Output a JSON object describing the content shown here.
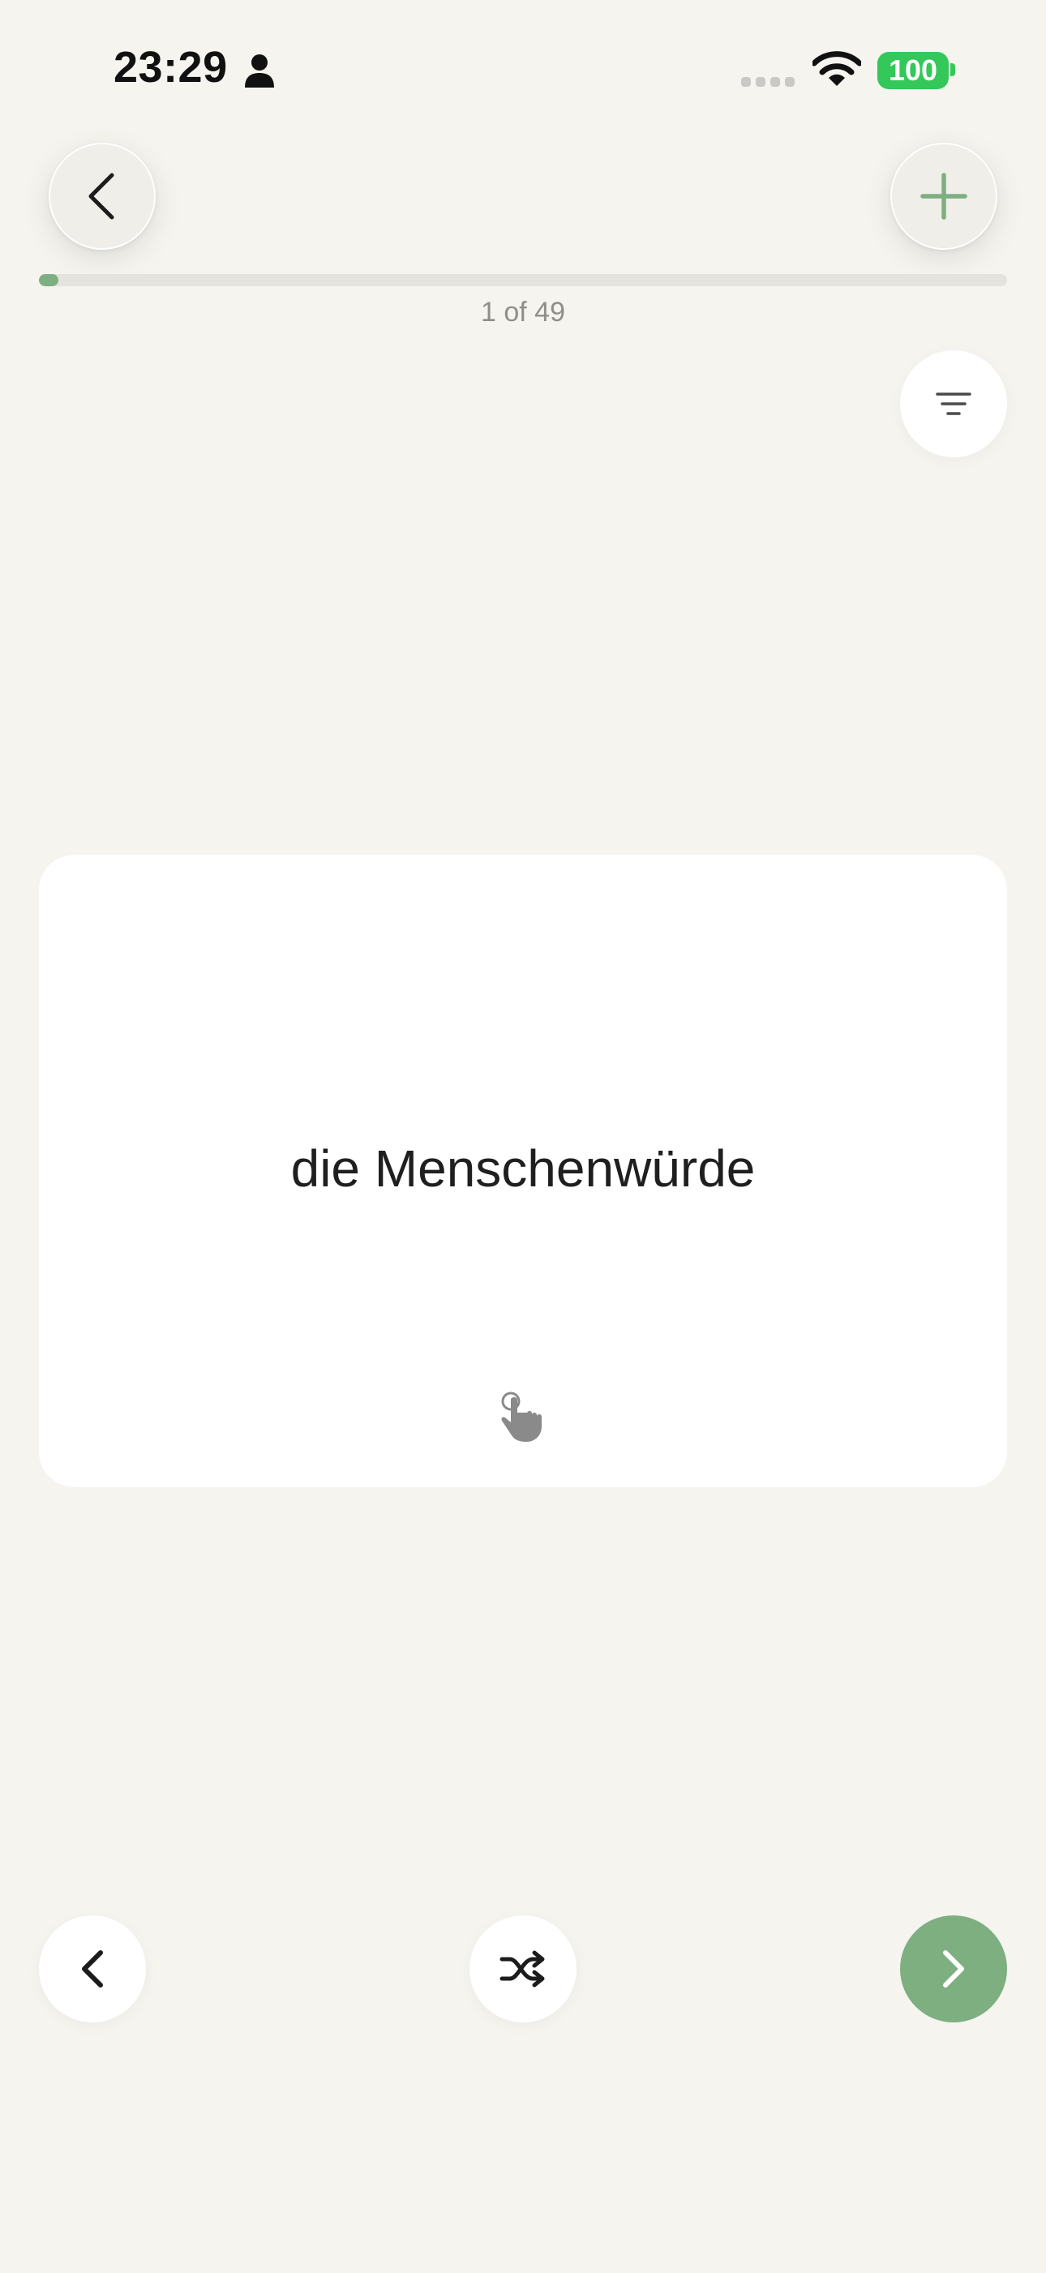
{
  "status_bar": {
    "time": "23:29",
    "battery": "100"
  },
  "header": {
    "back_icon": "chevron-left-icon",
    "add_icon": "plus-icon",
    "filter_icon": "filter-lines-icon"
  },
  "progress": {
    "current": 1,
    "total": 49,
    "label": "1 of 49"
  },
  "card": {
    "front_text": "die Menschenwürde",
    "hint_icon": "tap-hand-icon"
  },
  "bottom_nav": {
    "prev_icon": "chevron-left-icon",
    "shuffle_icon": "shuffle-icon",
    "next_icon": "chevron-right-icon"
  },
  "colors": {
    "background": "#f5f4ef",
    "accent": "#7daf80",
    "battery": "#34c759",
    "card": "#ffffff"
  }
}
